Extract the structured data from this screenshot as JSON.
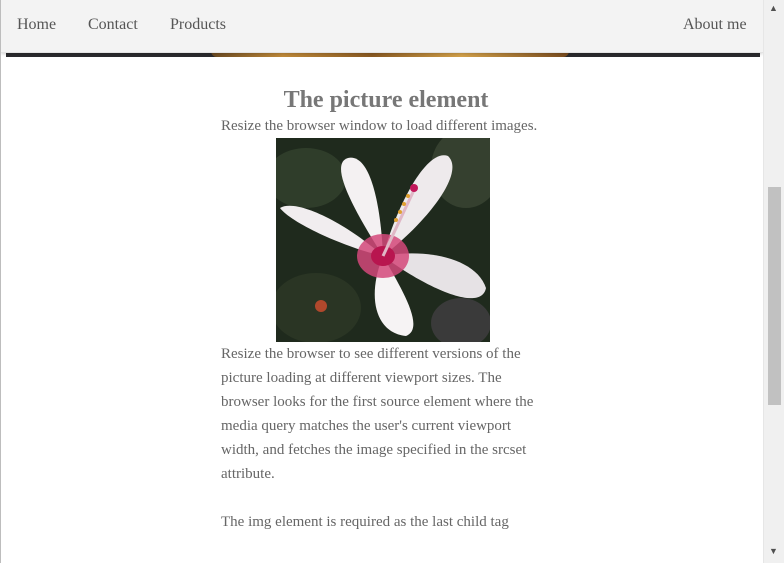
{
  "nav": {
    "home": "Home",
    "contact": "Contact",
    "products": "Products",
    "about": "About me"
  },
  "article": {
    "title": "The picture element",
    "intro": "Resize the browser window to load different images.",
    "body1": "Resize the browser to see different versions of the picture loading at different viewport sizes. The browser looks for the first source element where the media query matches the user's current viewport width, and fetches the image specified in the srcset attribute.",
    "body2": "The img element is required as the last child tag"
  },
  "colors": {
    "navbar_bg": "#f3f3f3",
    "text": "#666666",
    "heading": "#777777"
  }
}
